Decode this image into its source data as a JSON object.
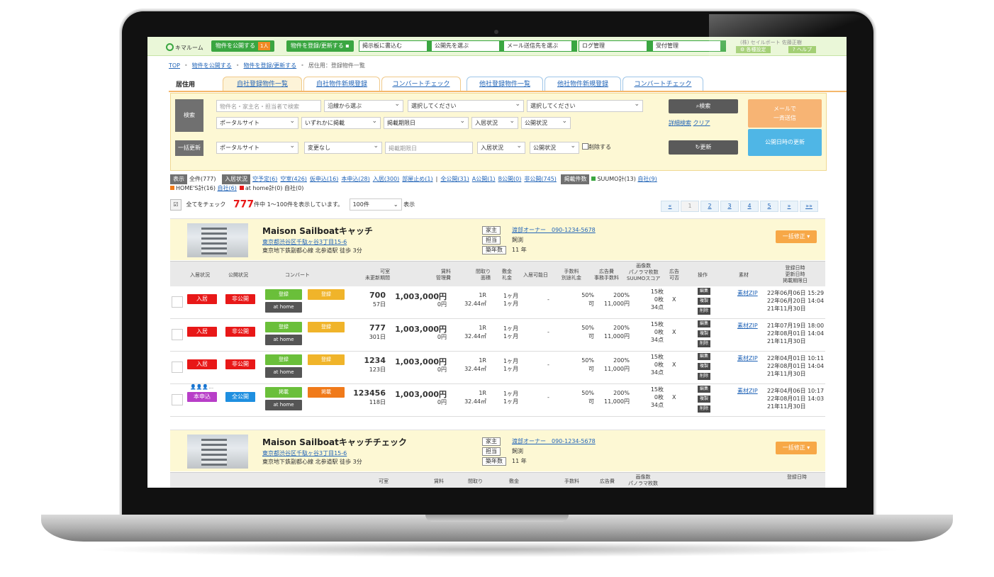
{
  "topbar": {
    "logo": "キマルーム",
    "publish_btn": "物件を公開する",
    "publish_badge": "1人",
    "register_btn": "物件を登録/更新する",
    "board_sel": "掲示板に書込む",
    "pubdest_sel": "公開先を選ぶ",
    "mail_sel": "メール送信先を選ぶ",
    "log_sel": "ログ管理",
    "reception_sel": "受付管理",
    "company": "(株) セイルボート 佐藤正樹",
    "settings_btn": "各種設定",
    "help_btn": "ヘルプ"
  },
  "breadcrumb": {
    "top": "TOP",
    "publish": "物件を公開する",
    "register": "物件を登録/更新する",
    "current": "居住用：登録物件一覧"
  },
  "tabs": {
    "section": "居住用",
    "items": [
      "自社登録物件一覧",
      "自社物件新規登録",
      "コンバートチェック",
      "他社登録物件一覧",
      "他社物件新規登録",
      "コンバートチェック"
    ]
  },
  "search": {
    "label": "検索",
    "keyword_placeholder": "物件名・家主名・担当者で検索",
    "line_sel": "沿線から選ぶ",
    "select1": "選択してください",
    "select2": "選択してください",
    "portal_sel": "ポータルサイト",
    "listed_sel": "いずれかに掲載",
    "deadline_sel": "掲載期限日",
    "occupancy_sel": "入居状況",
    "public_sel": "公開状況",
    "search_btn": "検索",
    "detail_link": "詳細検索",
    "clear_link": "クリア",
    "mail_btn_line1": "メールで",
    "mail_btn_line2": "一斉送信",
    "bulk_label": "一括更新",
    "bulk_portal": "ポータルサイト",
    "bulk_nochange": "変更なし",
    "bulk_deadline_placeholder": "掲載期限日",
    "bulk_occupancy": "入居状況",
    "bulk_public": "公開状況",
    "delete_label": "削除する",
    "update_btn": "更新",
    "pubdate_btn": "公開日時の更新"
  },
  "filters": {
    "display_label": "表示",
    "all": "全件(777)",
    "occupancy_label": "入居状況",
    "occupancy_links": [
      "空予定(6)",
      "空室(426)",
      "仮申込(16)",
      "本申込(28)",
      "入居(300)",
      "部屋止め(1)"
    ],
    "public_links": [
      "全公開(31)",
      "A公開(1)",
      "B公開(0)",
      "非公開(745)"
    ],
    "listing_label": "掲載件数",
    "suumo": "SUUMO計(13)",
    "suumo_own": "自社(9)",
    "homes": "HOME'S計(16)",
    "homes_own": "自社(6)",
    "athome": "at home計(0)",
    "athome_own": "自社(0)"
  },
  "checkrow": {
    "check_all": "全てをチェック",
    "count": "777",
    "range": "件中 1〜100件を表示しています。",
    "per_page": "100件",
    "display": "表示"
  },
  "pager": [
    "«",
    "1",
    "2",
    "3",
    "4",
    "5",
    "»",
    "»»"
  ],
  "properties": [
    {
      "name": "Maison Sailboatキャッチ",
      "address": "東京都渋谷区千駄ヶ谷3丁目15-6",
      "station": "東京地下鉄副都心線 北参道駅 徒歩 3分",
      "owner_label": "家主",
      "owner": "渡部オーナー　090-1234-5678",
      "staff_label": "担当",
      "staff": "飼渕",
      "age_label": "築年数",
      "age": "11 年",
      "bulk_btn": "一括修正 ▾"
    },
    {
      "name": "Maison Sailboatキャッチチェック",
      "address": "東京都渋谷区千駄ヶ谷3丁目15-6",
      "station": "東京地下鉄副都心線 北参道駅 徒歩 3分",
      "owner_label": "家主",
      "owner": "渡部オーナー　090-1234-5678",
      "staff_label": "担当",
      "staff": "飼渕",
      "age_label": "築年数",
      "age": "11 年",
      "bulk_btn": "一括修正 ▾"
    }
  ],
  "table_head": {
    "occupancy": "入居状況",
    "public": "公開状況",
    "convert": "コンバート",
    "vacancy_1": "可室",
    "vacancy_2": "未更新期間",
    "rent_1": "賃料",
    "rent_2": "管理費",
    "layout_1": "間取り",
    "layout_2": "面積",
    "deposit_1": "敷金",
    "deposit_2": "礼金",
    "movein": "入居可能日",
    "fee_1": "手数料",
    "fee_2": "別途礼金",
    "ad_1": "広告費",
    "ad_2": "事務手数料",
    "img_1": "画像数",
    "img_2": "パノラマ枚数",
    "img_3": "SUUMOスコア",
    "adok_1": "広告",
    "adok_2": "可否",
    "ops": "操作",
    "material": "素材",
    "date_1": "登録日時",
    "date_2": "更新日時",
    "date_3": "掲載期限日"
  },
  "rows": [
    {
      "occ": "入居",
      "occ_color": "#e81818",
      "pub": "非公開",
      "pub_color": "#e81818",
      "conv1": "登録",
      "conv2": "登録",
      "conv2_color": "#f0b42a",
      "athome": "at home",
      "rooms": "700",
      "days": "57日",
      "rent": "1,003,000円",
      "mgmt": "0円",
      "layout": "1R",
      "area": "32.44㎡",
      "deposit": "1ヶ月",
      "key": "1ヶ月",
      "movein": "-",
      "fee": "50%",
      "fee2": "可",
      "ad": "200%",
      "ad2": "11,000円",
      "img": "15枚",
      "pano": "0枚",
      "score": "34点",
      "adok": "X",
      "ops": [
        "編集",
        "複製",
        "削除"
      ],
      "material": "素材ZIP",
      "d1": "22年06月06日 15:29",
      "d2": "22年06月20日 14:04",
      "d3": "21年11月30日",
      "marker": ""
    },
    {
      "occ": "入居",
      "occ_color": "#e81818",
      "pub": "非公開",
      "pub_color": "#e81818",
      "conv1": "登録",
      "conv2": "登録",
      "conv2_color": "#f0b42a",
      "athome": "at home",
      "rooms": "777",
      "days": "301日",
      "rent": "1,003,000円",
      "mgmt": "0円",
      "layout": "1R",
      "area": "32.44㎡",
      "deposit": "1ヶ月",
      "key": "1ヶ月",
      "movein": "-",
      "fee": "50%",
      "fee2": "可",
      "ad": "200%",
      "ad2": "11,000円",
      "img": "15枚",
      "pano": "0枚",
      "score": "34点",
      "adok": "X",
      "ops": [
        "編集",
        "複製",
        "削除"
      ],
      "material": "素材ZIP",
      "d1": "21年07月19日 18:00",
      "d2": "22年08月01日 14:04",
      "d3": "21年11月30日",
      "marker": ""
    },
    {
      "occ": "入居",
      "occ_color": "#e81818",
      "pub": "非公開",
      "pub_color": "#e81818",
      "conv1": "登録",
      "conv2": "登録",
      "conv2_color": "#f0b42a",
      "athome": "at home",
      "rooms": "1234",
      "days": "123日",
      "rent": "1,003,000円",
      "mgmt": "0円",
      "layout": "1R",
      "area": "32.44㎡",
      "deposit": "1ヶ月",
      "key": "1ヶ月",
      "movein": "-",
      "fee": "50%",
      "fee2": "可",
      "ad": "200%",
      "ad2": "11,000円",
      "img": "15枚",
      "pano": "0枚",
      "score": "34点",
      "adok": "X",
      "ops": [
        "編集",
        "複製",
        "削除"
      ],
      "material": "素材ZIP",
      "d1": "22年04月01日 10:11",
      "d2": "22年08月01日 14:04",
      "d3": "21年11月30日",
      "marker": ""
    },
    {
      "occ": "本申込",
      "occ_color": "#b83ec8",
      "pub": "全公開",
      "pub_color": "#1e8fe0",
      "conv1": "掲載",
      "conv2": "掲載",
      "conv2_color": "#f07a1a",
      "athome": "at home",
      "rooms": "123456",
      "days": "118日",
      "rent": "1,003,000円",
      "mgmt": "0円",
      "layout": "1R",
      "area": "32.44㎡",
      "deposit": "1ヶ月",
      "key": "1ヶ月",
      "movein": "-",
      "fee": "50%",
      "fee2": "可",
      "ad": "200%",
      "ad2": "11,000円",
      "img": "15枚",
      "pano": "0枚",
      "score": "34点",
      "adok": "X",
      "ops": [
        "編集",
        "複製",
        "削除"
      ],
      "material": "素材ZIP",
      "d1": "22年04月06日 10:17",
      "d2": "22年08月01日 14:03",
      "d3": "21年11月30日",
      "marker": "👤👤👤…"
    }
  ],
  "table_head_partial": {
    "vacancy": "可室",
    "rent": "賃料",
    "layout": "間取り",
    "deposit": "敷金",
    "fee": "手数料",
    "ad": "広告費",
    "img": "画像数",
    "pano": "パノラマ枚数",
    "date": "登録日時"
  },
  "colors": {
    "brand_green": "#3aa641",
    "accent_orange": "#f7a847",
    "link_blue": "#2466b8",
    "red": "#e81818"
  }
}
